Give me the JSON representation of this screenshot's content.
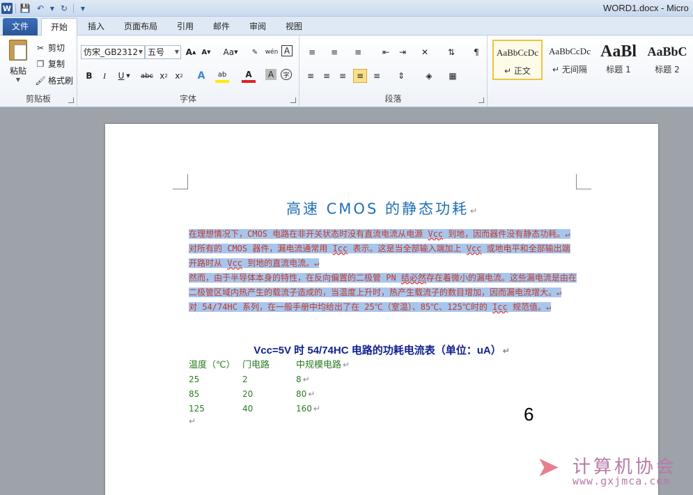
{
  "window": {
    "title": "WORD1.docx - Micro"
  },
  "qat": {
    "word_logo": "W"
  },
  "tabs": [
    {
      "label": "文件"
    },
    {
      "label": "开始"
    },
    {
      "label": "插入"
    },
    {
      "label": "页面布局"
    },
    {
      "label": "引用"
    },
    {
      "label": "邮件"
    },
    {
      "label": "审阅"
    },
    {
      "label": "视图"
    }
  ],
  "ribbon": {
    "clipboard": {
      "paste": "粘贴",
      "cut": "剪切",
      "copy": "复制",
      "format_painter": "格式刷",
      "label": "剪贴板"
    },
    "font": {
      "font_name": "仿宋_GB2312",
      "font_size": "五号",
      "label": "字体"
    },
    "paragraph": {
      "label": "段落"
    },
    "styles": [
      {
        "sample": "AaBbCcDc",
        "name": "正文"
      },
      {
        "sample": "AaBbCcDc",
        "name": "无间隔"
      },
      {
        "sample": "AaBl",
        "name": "标题 1"
      },
      {
        "sample": "AaBbC",
        "name": "标题 2"
      }
    ]
  },
  "document": {
    "title": "高速 CMOS 的静态功耗",
    "para_mark": "↵",
    "p1a": "在理想情况下，CMOS 电路在非开关状态时没有直流电流从电源 ",
    "p1vcc": "Vcc",
    "p1b": " 到地，因而器件没有静态功耗。",
    "p2a": "对所有的 CMOS 器件，漏电流通常用 ",
    "p2icc": "Icc",
    "p2b": " 表示。这是当全部输入端加上 ",
    "p2vcc": "Vcc",
    "p2c": " 或地电平和全部输出端开路时从 ",
    "p2vcc2": "Vcc",
    "p2d": " 到地的直流电流。",
    "p3a": "然而，由于半导体本身的特性，在反向偏置的二极管 PN ",
    "p3ul": "结必然",
    "p3b": "存在着微小的漏电流。这些漏电流是由在二极管区域内热产生的载流子造成的，当温度上升时，热产生载流子的数目增加，因而漏电流增大。",
    "p4a": "对 54/74HC 系列，在一般手册中均给出了在 25℃（室温）、85℃、125℃时的 ",
    "p4icc": "Icc",
    "p4b": " 规范值。",
    "table_title": "Vcc=5V 时 54/74HC 电路的功耗电流表（单位：uA）",
    "table": {
      "headers": [
        "温度（℃）",
        "门电路",
        "中规模电路"
      ],
      "rows": [
        [
          "25",
          "2",
          "8"
        ],
        [
          "85",
          "20",
          "80"
        ],
        [
          "125",
          "40",
          "160"
        ]
      ]
    }
  },
  "overlay": {
    "page_number": "6",
    "watermark_name": "计算机协会",
    "watermark_url": "www.gxjmca.com"
  }
}
